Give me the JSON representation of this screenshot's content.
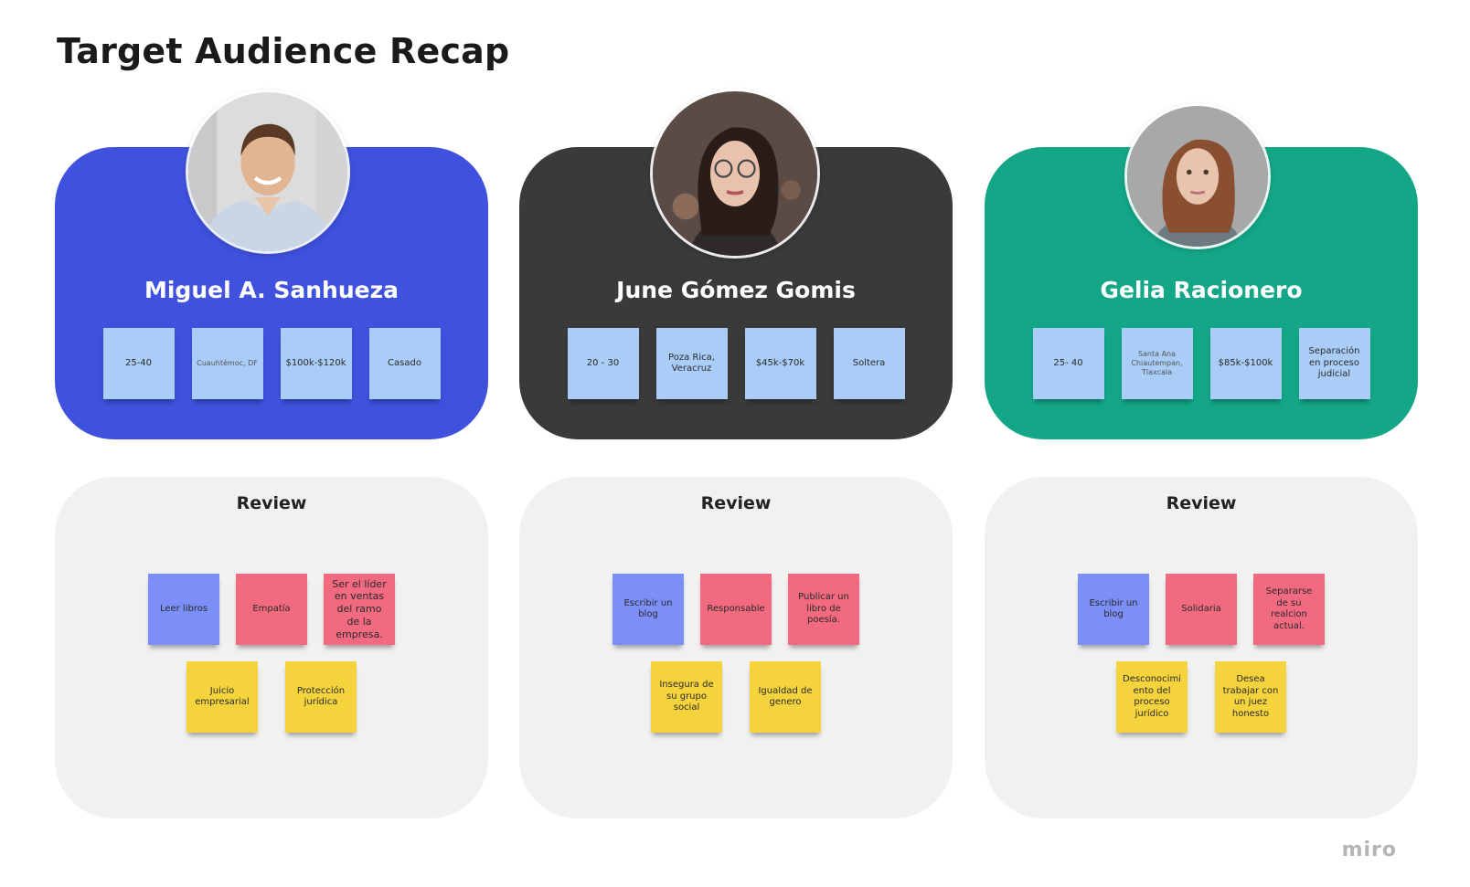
{
  "title": "Target Audience Recap",
  "colors": {
    "card_blue": "#3f51dd",
    "card_dark": "#3a3a3a",
    "card_green": "#13a787",
    "tag_blue": "#a9cdf6",
    "note_blue": "#7b8ff7",
    "note_red": "#f16a80",
    "note_yellow": "#f5d33c",
    "review_bg": "#f1f1f1"
  },
  "personas": [
    {
      "name": "Miguel A. Sanhueza",
      "tags": [
        "25-40",
        "Cuauhtémoc, DF",
        "$100k-$120k",
        "Casado"
      ],
      "review_title": "Review",
      "review_row1": [
        "Leer libros",
        "Empatía",
        "Ser el líder en ventas del ramo de la empresa."
      ],
      "review_row2": [
        "Juicio empresarial",
        "Protección jurídica"
      ]
    },
    {
      "name": "June Gómez Gomis",
      "tags": [
        "20 - 30",
        "Poza Rica, Veracruz",
        "$45k-$70k",
        "Soltera"
      ],
      "review_title": "Review",
      "review_row1": [
        "Escribir un blog",
        "Responsable",
        "Publicar un libro de poesía."
      ],
      "review_row2": [
        "Insegura de su grupo social",
        "Igualdad de genero"
      ]
    },
    {
      "name": "Gelia Racionero",
      "tags": [
        "25- 40",
        "Santa Ana Chiautempan, Tlaxcala",
        "$85k-$100k",
        "Separación en proceso judicial"
      ],
      "review_title": "Review",
      "review_row1": [
        "Escribir un blog",
        "Solidaria",
        "Separarse de su realcion actual."
      ],
      "review_row2": [
        "Desconocimi ento del proceso jurídico",
        "Desea trabajar con un juez honesto"
      ]
    }
  ],
  "logo": "miro"
}
